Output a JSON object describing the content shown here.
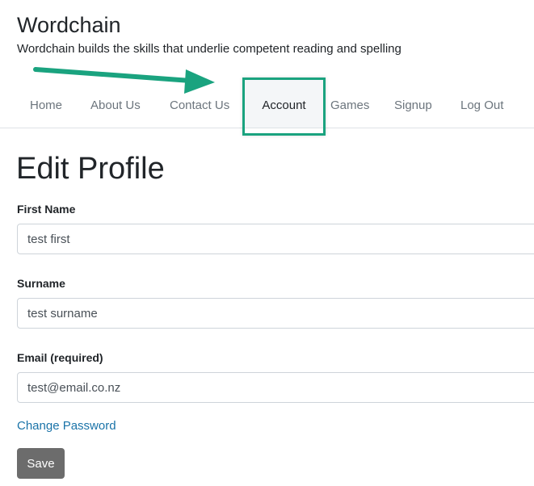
{
  "site": {
    "title": "Wordchain",
    "tagline": "Wordchain builds the skills that underlie competent reading and spelling"
  },
  "nav": {
    "items": [
      {
        "label": "Home"
      },
      {
        "label": "About Us"
      },
      {
        "label": "Contact Us"
      },
      {
        "label": "Account"
      },
      {
        "label": "Games"
      },
      {
        "label": "Signup"
      },
      {
        "label": "Log Out"
      }
    ],
    "active": "Account"
  },
  "form": {
    "title": "Edit Profile",
    "first_name": {
      "label": "First Name",
      "value": "test first"
    },
    "surname": {
      "label": "Surname",
      "value": "test surname"
    },
    "email": {
      "label": "Email (required)",
      "value": "test@email.co.nz"
    },
    "change_password_label": "Change Password",
    "save_label": "Save"
  },
  "colors": {
    "annotation": "#1aa37f",
    "link": "#1a73a8",
    "button": "#6c6c6c"
  }
}
